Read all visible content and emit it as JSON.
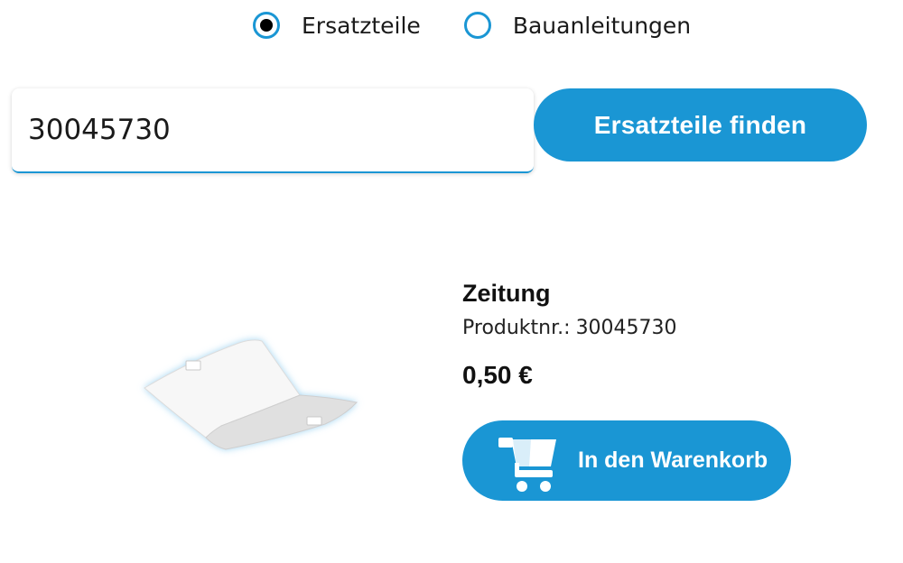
{
  "search_type": {
    "options": [
      {
        "label": "Ersatzteile",
        "selected": true
      },
      {
        "label": "Bauanleitungen",
        "selected": false
      }
    ]
  },
  "search": {
    "value": "30045730",
    "button_label": "Ersatzteile finden"
  },
  "product": {
    "name": "Zeitung",
    "number_label": "Produktnr.:",
    "number_value": "30045730",
    "price": "0,50 €",
    "cart_button_label": "In den Warenkorb",
    "cart_icon": "shopping-cart-icon"
  },
  "colors": {
    "accent": "#1a96d4",
    "text": "#1a1a1a",
    "button_text": "#ffffff"
  }
}
